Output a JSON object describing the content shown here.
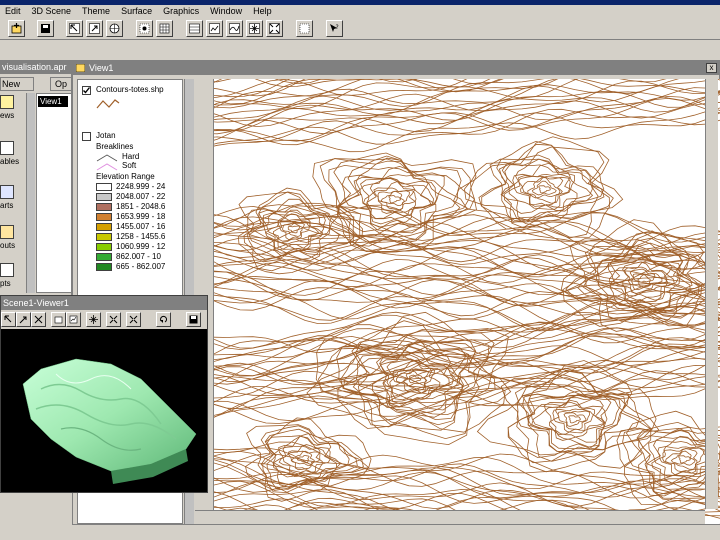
{
  "app": {
    "menus": [
      "Edit",
      "3D Scene",
      "Theme",
      "Surface",
      "Graphics",
      "Window",
      "Help"
    ]
  },
  "toolbar": {
    "buttons": [
      "add-theme",
      "save",
      "pointer",
      "zoom-in",
      "zoom-out",
      "pan",
      "select",
      "identify",
      "full-extent",
      "measure",
      "navigate",
      "zoom-extent",
      "layout",
      "help"
    ]
  },
  "project": {
    "title": "visualisation.apr",
    "new_label": "New",
    "open_label": "Op",
    "doc_types": [
      "Views",
      "Tables",
      "Charts",
      "Layouts",
      "Scripts"
    ],
    "doc_labels": [
      "ews",
      "",
      "ables",
      "arts",
      "outs",
      "pts"
    ],
    "list_items": [
      "View1"
    ]
  },
  "view": {
    "title": "View1",
    "close_label": "x",
    "themes": [
      {
        "name": "Contours-totes.shp",
        "checked": true,
        "line_color": "#a0602a"
      },
      {
        "name": "Jotan",
        "checked": false,
        "breaklines_label": "Breaklines",
        "breakline_types": [
          "Hard",
          "Soft"
        ],
        "elevation_label": "Elevation Range",
        "ranges": [
          {
            "label": "2248.999 - 24",
            "color": "#ffffff"
          },
          {
            "label": "2048.007 - 22",
            "color": "#c8c8c8"
          },
          {
            "label": "1851 - 2048.6",
            "color": "#b07060"
          },
          {
            "label": "1653.999 - 18",
            "color": "#d08030"
          },
          {
            "label": "1455.007 - 16",
            "color": "#d4a000"
          },
          {
            "label": "1258 - 1455.6",
            "color": "#c8c800"
          },
          {
            "label": "1060.999 - 12",
            "color": "#88cc00"
          },
          {
            "label": "862.007 - 10",
            "color": "#33aa33"
          },
          {
            "label": "665 - 862.007",
            "color": "#228822"
          }
        ]
      }
    ],
    "contour_color": "#a0602a"
  },
  "scene": {
    "title": "Scene1-Viewer1",
    "buttons": [
      "navigate",
      "zoom",
      "pan",
      "select",
      "identify",
      "zoom-extent",
      "rotate",
      "fit",
      "refresh",
      "save"
    ],
    "terrain_color": "#9ee8b0"
  }
}
